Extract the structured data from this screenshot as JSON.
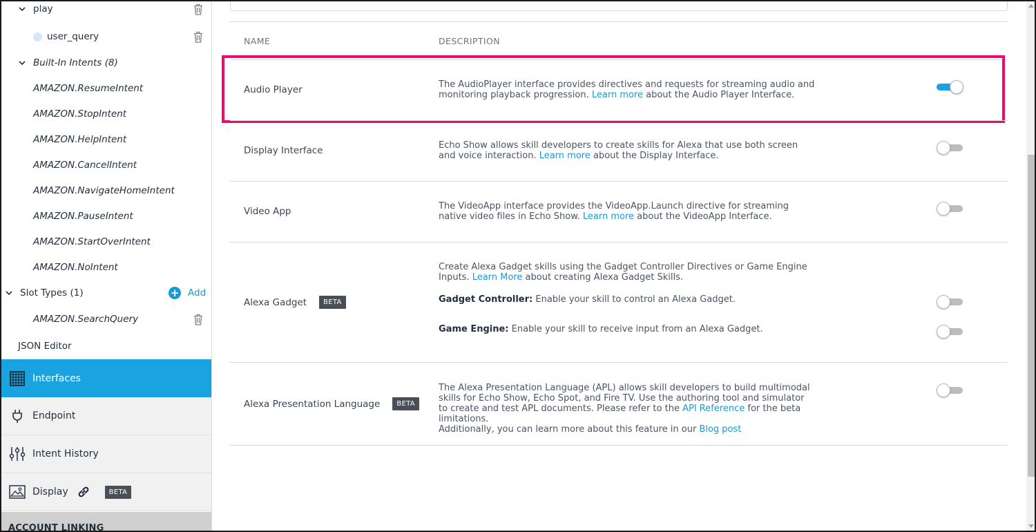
{
  "sidebar": {
    "tree": {
      "play": "play",
      "user_query": "user_query",
      "builtin_header": "Built-In Intents (8)",
      "builtin_intents": [
        "AMAZON.ResumeIntent",
        "AMAZON.StopIntent",
        "AMAZON.HelpIntent",
        "AMAZON.CancelIntent",
        "AMAZON.NavigateHomeIntent",
        "AMAZON.PauseIntent",
        "AMAZON.StartOverIntent",
        "AMAZON.NoIntent"
      ],
      "slot_types_header": "Slot Types (1)",
      "add_label": "Add",
      "slot_type": "AMAZON.SearchQuery",
      "json_editor": "JSON Editor"
    },
    "nav": {
      "interfaces": "Interfaces",
      "endpoint": "Endpoint",
      "intent_history": "Intent History",
      "display": "Display",
      "display_badge": "BETA"
    },
    "account_linking": "ACCOUNT LINKING"
  },
  "main": {
    "columns": {
      "name": "NAME",
      "description": "DESCRIPTION"
    },
    "interfaces": {
      "audio_player": {
        "name": "Audio Player",
        "desc_before": "The AudioPlayer interface provides directives and requests for streaming audio and monitoring playback progression. ",
        "link": "Learn more",
        "desc_after": " about the Audio Player Interface.",
        "enabled": true
      },
      "display_interface": {
        "name": "Display Interface",
        "desc_before": "Echo Show allows skill developers to create skills for Alexa that use both screen and voice interaction. ",
        "link": "Learn more",
        "desc_after": " about the Display Interface.",
        "enabled": false
      },
      "video_app": {
        "name": "Video App",
        "desc_before": "The VideoApp interface provides the VideoApp.Launch directive for streaming native video files in Echo Show. ",
        "link": "Learn more",
        "desc_after": " about the VideoApp Interface.",
        "enabled": false
      },
      "alexa_gadget": {
        "name": "Alexa Gadget",
        "badge": "BETA",
        "desc_before": "Create Alexa Gadget skills using the Gadget Controller Directives or Game Engine Inputs. ",
        "link": "Learn More",
        "desc_after": " about creating Alexa Gadget Skills.",
        "gadget_controller_label": "Gadget Controller:",
        "gadget_controller_text": " Enable your skill to control an Alexa Gadget.",
        "gadget_controller_enabled": false,
        "game_engine_label": "Game Engine:",
        "game_engine_text": " Enable your skill to receive input from an Alexa Gadget.",
        "game_engine_enabled": false
      },
      "apl": {
        "name": "Alexa Presentation Language",
        "badge": "BETA",
        "desc_1": "The Alexa Presentation Language (APL) allows skill developers to build multimodal skills for Echo Show, Echo Spot, and Fire TV. Use the authoring tool and simulator to create and test APL documents. Please refer to the ",
        "link_1": "API Reference",
        "desc_2": " for the beta limitations.",
        "desc_3": "Additionally, you can learn more about this feature in our ",
        "link_2": "Blog post",
        "enabled": false
      }
    }
  },
  "colors": {
    "accent": "#1aa3e1",
    "link": "#1a98d5",
    "highlight": "#ee0b6f",
    "badge": "#4a4e57"
  }
}
